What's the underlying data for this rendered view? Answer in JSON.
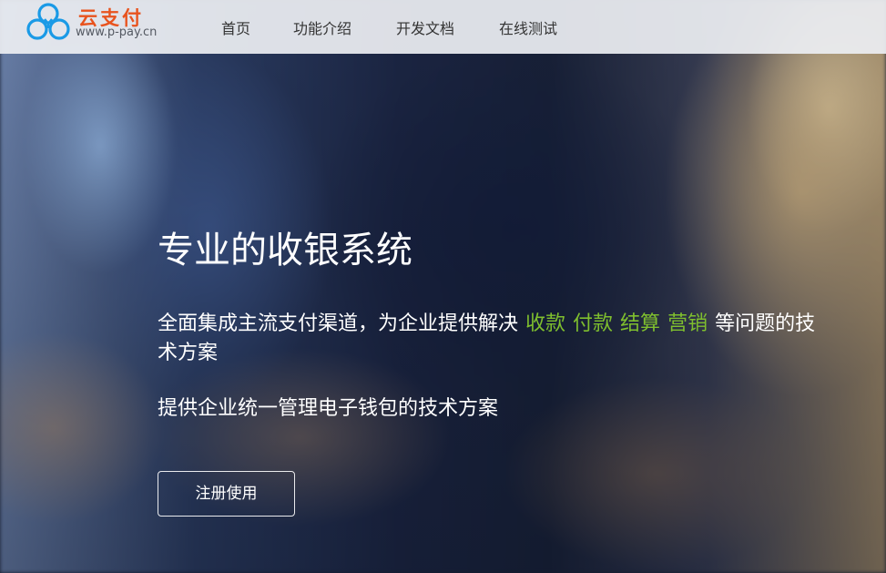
{
  "header": {
    "logo": {
      "name": "云支付",
      "url": "www.p-pay.cn",
      "icon": "cloud-logo-icon",
      "brand_color": "#e8531e",
      "icon_color": "#1a9ae6"
    },
    "nav": [
      {
        "label": "首页"
      },
      {
        "label": "功能介绍"
      },
      {
        "label": "开发文档"
      },
      {
        "label": "在线测试"
      }
    ]
  },
  "hero": {
    "title": "专业的收银系统",
    "description": {
      "before": "全面集成主流支付渠道，为企业提供解决",
      "highlights": [
        "收款",
        "付款",
        "结算",
        "营销"
      ],
      "after": "等问题的技术方案",
      "highlight_color": "#7fbf2e"
    },
    "subtitle": "提供企业统一管理电子钱包的技术方案",
    "register_button": "注册使用"
  }
}
